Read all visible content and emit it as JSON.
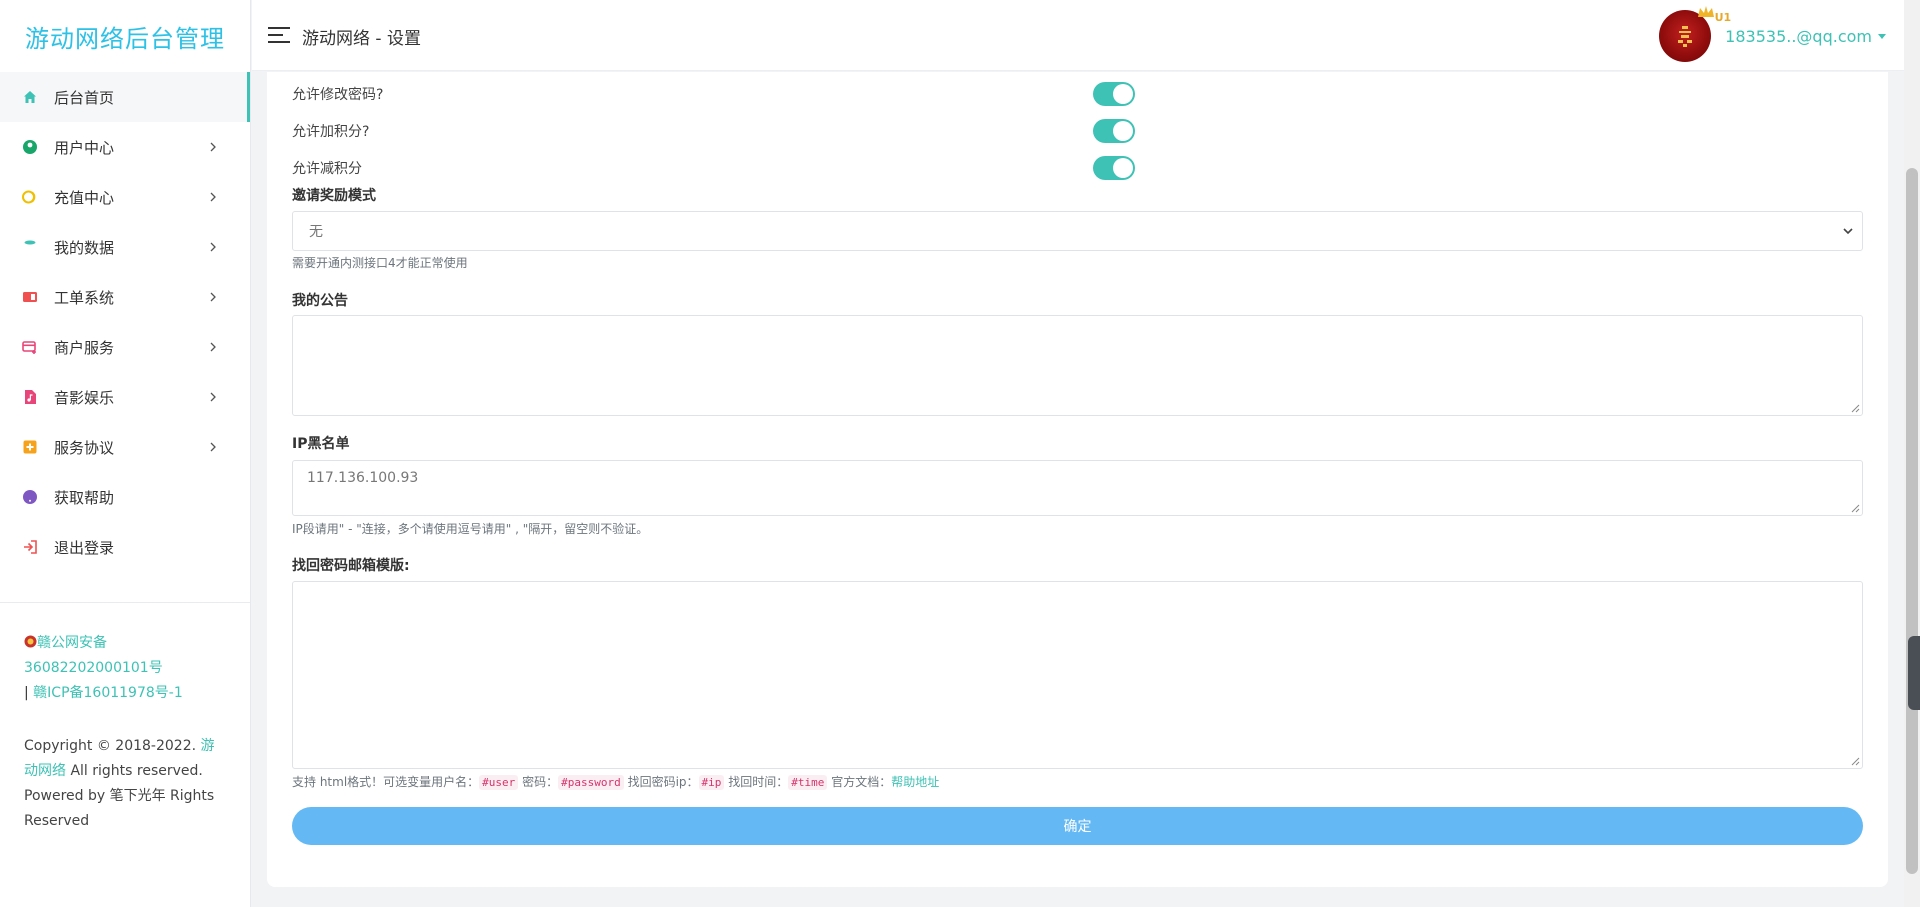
{
  "brand": {
    "title": "游动网络后台管理"
  },
  "sidebar": {
    "items": [
      {
        "label": "后台首页",
        "icon": "home-icon",
        "color": "#3dc2b5",
        "active": true,
        "has_children": false
      },
      {
        "label": "用户中心",
        "icon": "user-icon",
        "color": "#18a66b",
        "active": false,
        "has_children": true
      },
      {
        "label": "充值中心",
        "icon": "coin-icon",
        "color": "#f0c000",
        "active": false,
        "has_children": true
      },
      {
        "label": "我的数据",
        "icon": "database-icon",
        "color": "#3dc2b5",
        "active": false,
        "has_children": true
      },
      {
        "label": "工单系统",
        "icon": "ticket-icon",
        "color": "#f05050",
        "active": false,
        "has_children": true
      },
      {
        "label": "商户服务",
        "icon": "card-icon",
        "color": "#e8457a",
        "active": false,
        "has_children": true
      },
      {
        "label": "音影娱乐",
        "icon": "music-icon",
        "color": "#e8457a",
        "active": false,
        "has_children": true
      },
      {
        "label": "服务协议",
        "icon": "plus-square-icon",
        "color": "#f7a21b",
        "active": false,
        "has_children": true
      },
      {
        "label": "获取帮助",
        "icon": "help-icon",
        "color": "#7e57c2",
        "active": false,
        "has_children": false
      },
      {
        "label": "退出登录",
        "icon": "logout-icon",
        "color": "#f05050",
        "active": false,
        "has_children": false
      }
    ],
    "record": {
      "police": "赣公网安备 36082202000101号",
      "bar": "|",
      "icp": "赣ICP备16011978号-1"
    },
    "copyright": {
      "prefix": "Copyright © 2018-2022.",
      "brand": "游动网络",
      "rights": "All rights reserved.",
      "powered": "Powered by 笔下光年 Rights Reserved"
    }
  },
  "header": {
    "title": "游动网络 - 设置",
    "user_email": "183535..@qq.com",
    "vip_badge": "U1"
  },
  "form": {
    "toggles": [
      {
        "label": "允许修改密码?",
        "on": true
      },
      {
        "label": "允许加积分?",
        "on": true
      },
      {
        "label": "允许减积分",
        "on": true
      }
    ],
    "invite": {
      "label": "邀请奖励模式",
      "value": "无",
      "help": "需要开通内测接口4才能正常使用"
    },
    "notice": {
      "label": "我的公告",
      "value": ""
    },
    "ip_blacklist": {
      "label": "IP黑名单",
      "value": "117.136.100.93",
      "help": "IP段请用\" - \"连接，多个请使用逗号请用\" , \"隔开，留空则不验证。"
    },
    "email_template": {
      "label": "找回密码邮箱模版:",
      "value": "",
      "help_prefix": "支持 html格式！可选变量用户名：",
      "var_user": "#user",
      "help_pwd": "密码：",
      "var_password": "#password",
      "help_ip": "找回密码ip：",
      "var_ip": "#ip",
      "help_time": "找回时间：",
      "var_time": "#time",
      "help_docs": "官方文档：",
      "help_link": "帮助地址"
    },
    "submit_label": "确定"
  },
  "colors": {
    "accent": "#3dc2b5",
    "brand": "#2dc1e6",
    "submit": "#64b9f5"
  }
}
